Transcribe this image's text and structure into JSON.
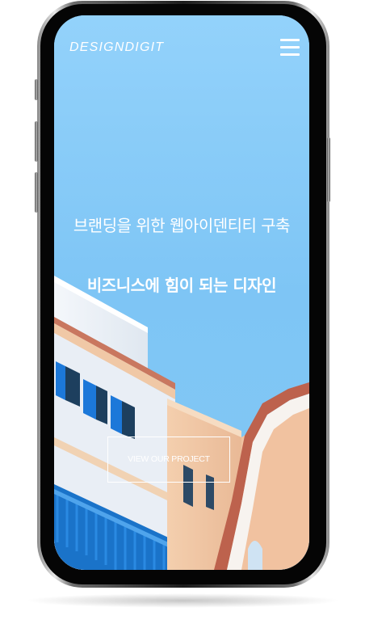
{
  "header": {
    "logo": "DESIGNDIGIT"
  },
  "hero": {
    "subtitle": "브랜딩을 위한 웹아이덴티티 구축",
    "title": "비즈니스에 힘이 되는 디자인",
    "cta_label": "VIEW OUR PROJECT"
  },
  "colors": {
    "sky": "#80c6f4",
    "wall_white": "#eef3f8",
    "wall_peach": "#f0c7a5",
    "shutter_blue": "#1b76d6",
    "roof_tile": "#c26a55",
    "phone_frame": "#1c1c1c"
  },
  "icons": {
    "menu": "hamburger-menu-icon"
  }
}
